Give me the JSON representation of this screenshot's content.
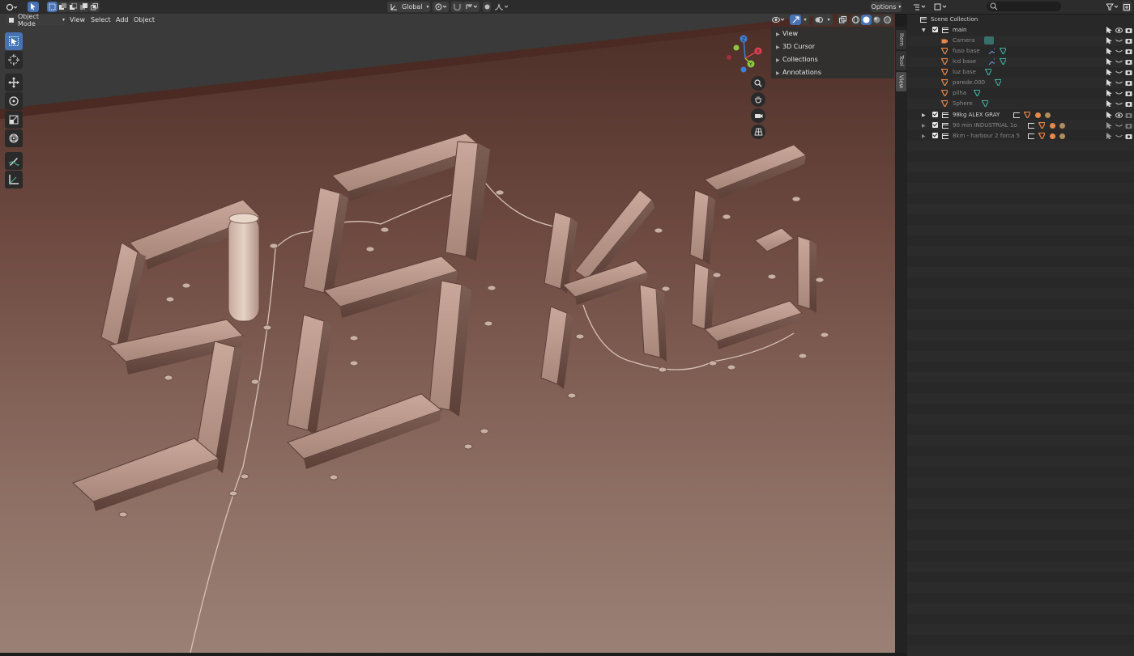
{
  "topbar": {
    "orientation": "Global",
    "options_label": "Options"
  },
  "header": {
    "mode": "Object Mode",
    "menus": [
      "View",
      "Select",
      "Add",
      "Object"
    ]
  },
  "npanel": {
    "sections": [
      "View",
      "3D Cursor",
      "Collections",
      "Annotations"
    ],
    "tabs": [
      "Item",
      "Tool",
      "View"
    ],
    "active_tab": "View"
  },
  "outliner": {
    "root": "Scene Collection",
    "rows": [
      {
        "label": "main",
        "kind": "collection",
        "level": 1,
        "dim": false
      },
      {
        "label": "Camera",
        "kind": "camera",
        "level": 2,
        "dim": true
      },
      {
        "label": "fuso base",
        "kind": "mesh",
        "level": 2,
        "dim": true
      },
      {
        "label": "lcd base",
        "kind": "mesh",
        "level": 2,
        "dim": true
      },
      {
        "label": "luz base",
        "kind": "mesh",
        "level": 2,
        "dim": true
      },
      {
        "label": "parede.000",
        "kind": "mesh",
        "level": 2,
        "dim": true
      },
      {
        "label": "pilha",
        "kind": "mesh",
        "level": 2,
        "dim": true
      },
      {
        "label": "Sphere",
        "kind": "mesh",
        "level": 2,
        "dim": true
      },
      {
        "label": "98kg ALEX GRAY",
        "kind": "collection",
        "level": 1,
        "dim": false
      },
      {
        "label": "90 min INDUSTRIAL 1o",
        "kind": "collection",
        "level": 1,
        "dim": true
      },
      {
        "label": "8km - harbour 2 forca 5",
        "kind": "collection",
        "level": 1,
        "dim": true
      }
    ]
  },
  "colors": {
    "accent": "#4772b3",
    "mesh_icon": "#e8894a",
    "modifier_icon": "#3fb3a3",
    "wall_top": "#4b2e27",
    "wall_bottom": "#9a8075"
  }
}
